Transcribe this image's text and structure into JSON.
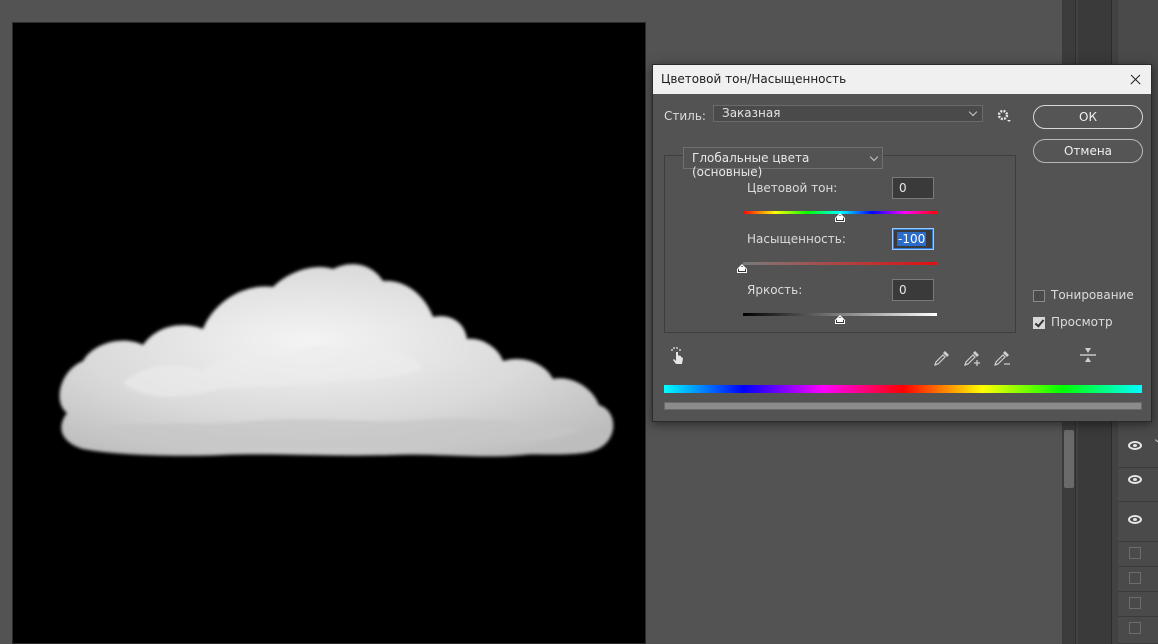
{
  "dialog": {
    "title": "Цветовой тон/Насыщенность",
    "style_label": "Стиль:",
    "style_value": "Заказная",
    "ok_label": "ОК",
    "cancel_label": "Отмена",
    "channel_value": "Глобальные цвета (основные)",
    "hue": {
      "label": "Цветовой тон:",
      "value": "0"
    },
    "saturation": {
      "label": "Насыщенность:",
      "value": "-100"
    },
    "lightness": {
      "label": "Яркость:",
      "value": "0"
    },
    "colorize": {
      "label": "Тонирование",
      "checked": false
    },
    "preview": {
      "label": "Просмотр",
      "checked": true
    },
    "icons": [
      "targeted-adjustment-icon",
      "eyedropper-icon",
      "eyedropper-plus-icon",
      "eyedropper-minus-icon",
      "range-icon",
      "gear-icon",
      "close-icon"
    ]
  },
  "layers_panel": {
    "icons": [
      "eye-icon",
      "eye-icon",
      "eye-icon"
    ]
  }
}
